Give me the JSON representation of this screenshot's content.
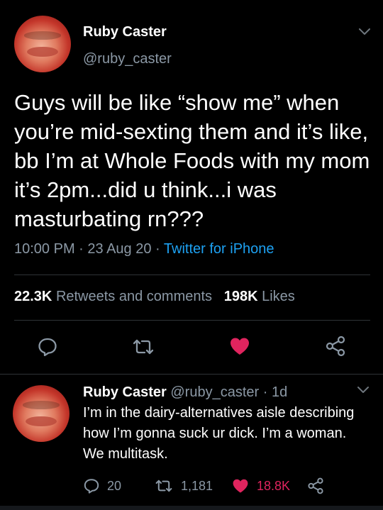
{
  "colors": {
    "background": "#000000",
    "text": "#ffffff",
    "muted": "#8b98a5",
    "link": "#1da1f2",
    "like": "#e0245e",
    "divider": "#2f3336"
  },
  "main_tweet": {
    "display_name": "Ruby Caster",
    "handle": "@ruby_caster",
    "text": "Guys will be like “show me” when you’re mid-sexting them and it’s like, bb I’m at Whole Foods with my mom it’s 2pm...did u think...i was masturbating rn???",
    "time": "10:00 PM",
    "date": "23 Aug 20",
    "source": "Twitter for iPhone",
    "retweets_count": "22.3K",
    "retweets_label": "Retweets and comments",
    "likes_count": "198K",
    "likes_label": "Likes",
    "icons": [
      "reply-icon",
      "retweet-icon",
      "like-icon",
      "share-icon"
    ],
    "liked": true
  },
  "reply_tweet": {
    "display_name": "Ruby Caster",
    "handle": "@ruby_caster",
    "age": "1d",
    "text": "I’m in the dairy-alternatives aisle describing how I’m gonna suck ur dick. I’m a woman. We multitask.",
    "reply_count": "20",
    "retweet_count": "1,181",
    "like_count": "18.8K",
    "liked": true
  },
  "separator": " · "
}
